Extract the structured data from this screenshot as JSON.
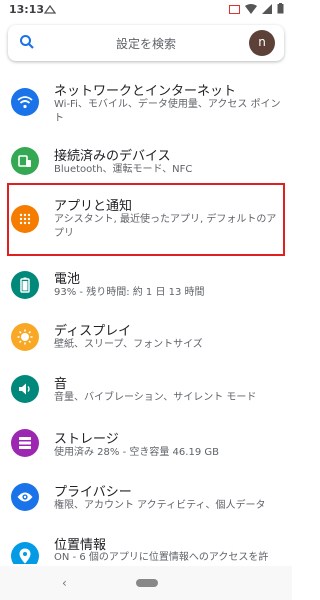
{
  "status": {
    "time": "13:13"
  },
  "search": {
    "placeholder": "設定を検索",
    "avatar_letter": "n"
  },
  "items": [
    {
      "title": "ネットワークとインターネット",
      "subtitle": "Wi-Fi、モバイル、データ使用量、アクセス ポイント",
      "icon": "wifi-icon",
      "color": "#1a73e8"
    },
    {
      "title": "接続済みのデバイス",
      "subtitle": "Bluetooth、運転モード、NFC",
      "icon": "devices-icon",
      "color": "#34a853"
    },
    {
      "title": "アプリと通知",
      "subtitle": "アシスタント, 最近使ったアプリ, デフォルトのアプリ",
      "icon": "apps-icon",
      "color": "#f57c00"
    },
    {
      "title": "電池",
      "subtitle": "93% - 残り時間: 約 1 日 13 時間",
      "icon": "battery-icon",
      "color": "#00897b"
    },
    {
      "title": "ディスプレイ",
      "subtitle": "壁紙、スリープ、フォントサイズ",
      "icon": "display-icon",
      "color": "#f9a825"
    },
    {
      "title": "音",
      "subtitle": "音量、バイブレーション、サイレント モード",
      "icon": "sound-icon",
      "color": "#00897b"
    },
    {
      "title": "ストレージ",
      "subtitle": "使用済み 28% - 空き容量 46.19 GB",
      "icon": "storage-icon",
      "color": "#9c27b0"
    },
    {
      "title": "プライバシー",
      "subtitle": "権限、アカウント アクティビティ、個人データ",
      "icon": "privacy-icon",
      "color": "#1a73e8"
    },
    {
      "title": "位置情報",
      "subtitle": "ON - 6 個のアプリに位置情報へのアクセスを許",
      "icon": "location-icon",
      "color": "#039be5"
    }
  ],
  "navbar": {
    "back": "‹"
  }
}
